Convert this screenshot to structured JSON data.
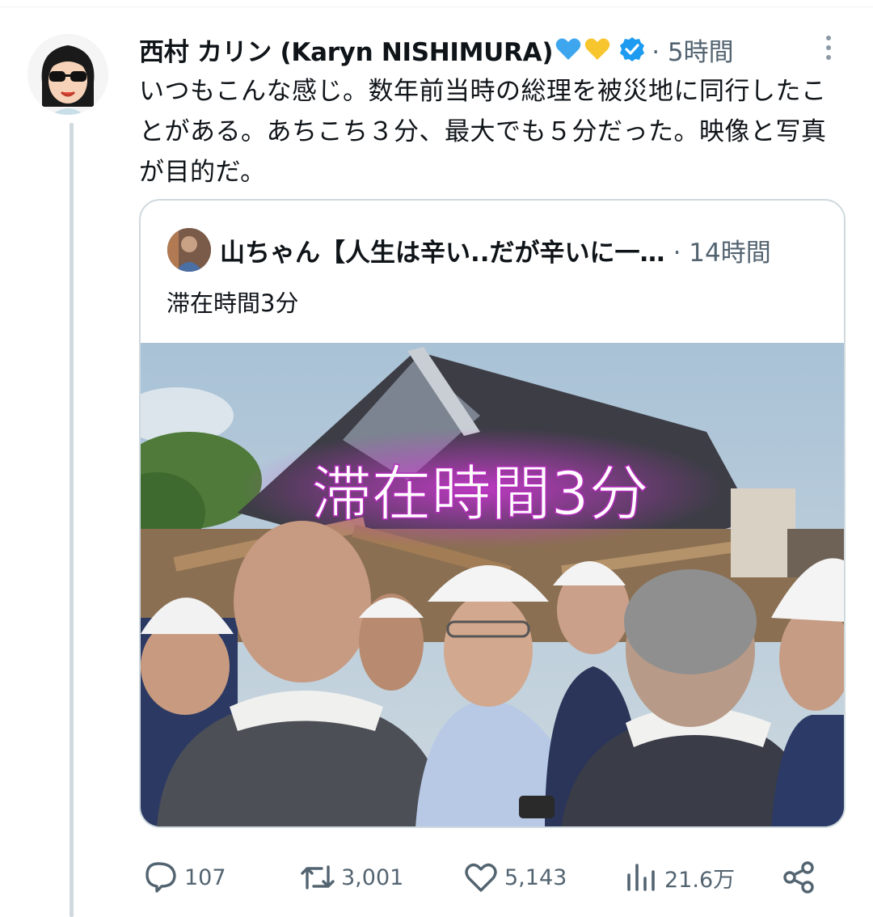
{
  "author": {
    "name": "西村 カリン (Karyn NISHIMURA)",
    "emojis": [
      "blue-heart",
      "yellow-heart"
    ],
    "verified": true,
    "time": "5時間"
  },
  "tweet": {
    "text": "いつもこんな感じ。数年前当時の総理を被災地に同行したことがある。あちこち３分、最大でも５分だった。映像と写真が目的だ。"
  },
  "quoted": {
    "name": "山ちゃん【人生は辛い..だが辛いに一…",
    "time": "14時間",
    "text": "滞在時間3分",
    "image_caption": "滞在時間3分"
  },
  "actions": {
    "replies": "107",
    "retweets": "3,001",
    "likes": "5,143",
    "views": "21.6万"
  },
  "colors": {
    "verified": "#1d9bf0",
    "muted": "#536471",
    "border": "#cfd9de"
  }
}
